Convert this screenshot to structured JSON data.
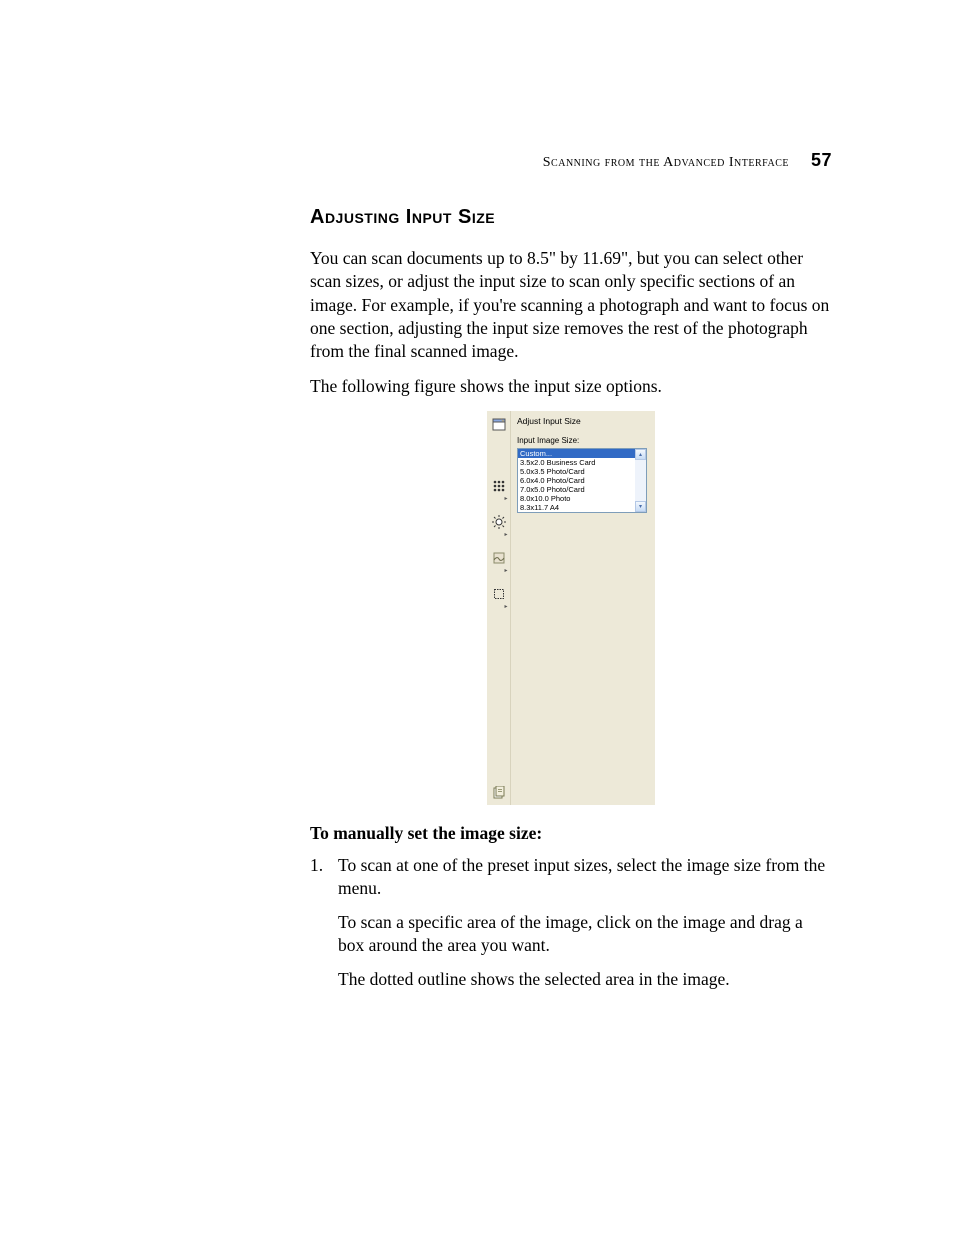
{
  "running_head": {
    "text": "Scanning from the Advanced Interface",
    "page_number": "57"
  },
  "section_title": "Adjusting Input Size",
  "paragraphs": {
    "p1": "You can scan documents up to 8.5\" by 11.69\", but you can select other scan sizes, or adjust the input size to scan only specific sections of an image. For example, if you're scanning a photograph and want to focus on one section, adjusting the input size removes the rest of the photograph from the final scanned image.",
    "p2": "The following figure shows the input size options."
  },
  "sub_head": "To manually set the image size:",
  "list": {
    "item1_num": "1.",
    "item1_text": "To scan at one of the preset input sizes, select the image size from the menu.",
    "cont1": "To scan a specific area of the image, click on the image and drag a box around the area you want.",
    "cont2": "The dotted outline shows the selected area in the image."
  },
  "figure": {
    "panel_title": "Adjust Input Size",
    "label": "Input Image Size:",
    "options": [
      "Custom...",
      "3.5x2.0 Business Card",
      "5.0x3.5 Photo/Card",
      "6.0x4.0 Photo/Card",
      "7.0x5.0 Photo/Card",
      "8.0x10.0 Photo",
      "8.3x11.7 A4"
    ],
    "selected_index": 0
  }
}
